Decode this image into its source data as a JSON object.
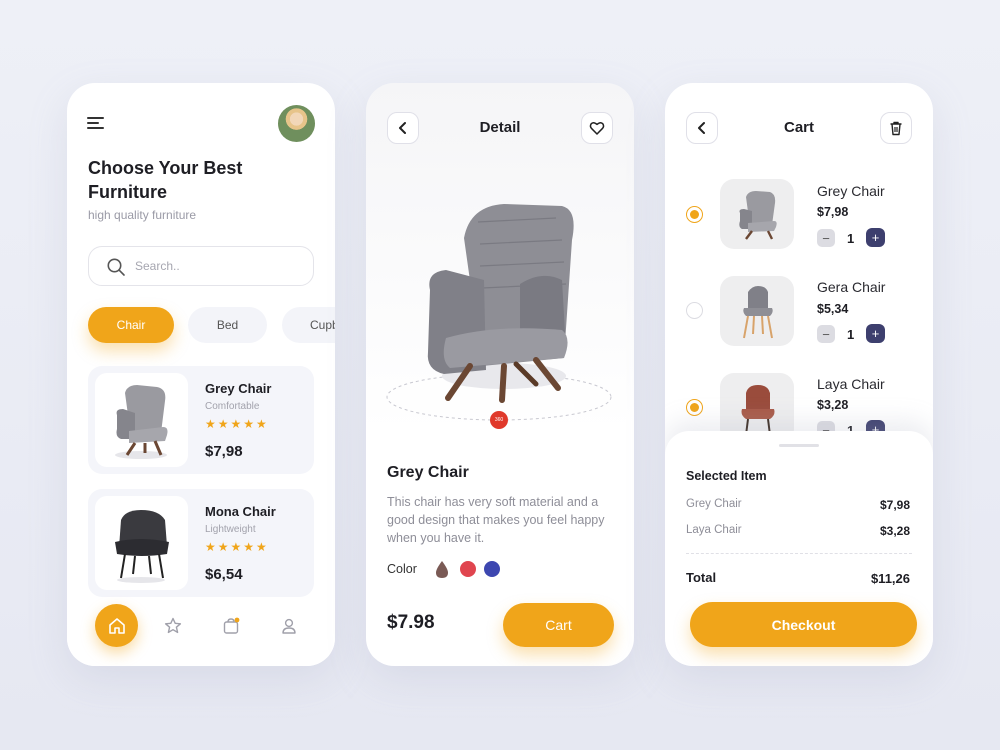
{
  "colors": {
    "accent": "#f0a51a",
    "dark_button": "#3d3f6e",
    "swatch_brown": "#7a5a55",
    "swatch_red": "#e0454f",
    "swatch_blue": "#3d47b0"
  },
  "home": {
    "title": "Choose Your Best Furniture",
    "subtitle": "high quality furniture",
    "search_placeholder": "Search..",
    "categories": [
      "Chair",
      "Bed",
      "Cupb"
    ],
    "products": [
      {
        "name": "Grey Chair",
        "tag": "Comfortable",
        "stars": "★★★★★",
        "price": "$7,98"
      },
      {
        "name": "Mona Chair",
        "tag": "Lightweight",
        "stars": "★★★★★",
        "price": "$6,54"
      }
    ],
    "nav": [
      "home-icon",
      "star-icon",
      "bag-icon",
      "profile-icon"
    ]
  },
  "detail": {
    "title": "Detail",
    "hotspot": "360",
    "name": "Grey Chair",
    "description": "This chair has very soft material and a good design that makes you feel happy when you have it.",
    "color_label": "Color",
    "price": "$7.98",
    "cart_label": "Cart"
  },
  "cart": {
    "title": "Cart",
    "items": [
      {
        "name": "Grey Chair",
        "price": "$7,98",
        "qty": "1",
        "selected": true
      },
      {
        "name": "Gera Chair",
        "price": "$5,34",
        "qty": "1",
        "selected": false
      },
      {
        "name": "Laya Chair",
        "price": "$3,28",
        "qty": "1",
        "selected": true
      }
    ],
    "minus": "−",
    "plus": "+",
    "selected_title": "Selected Item",
    "selected": [
      {
        "name": "Grey Chair",
        "price": "$7,98"
      },
      {
        "name": "Laya Chair",
        "price": "$3,28"
      }
    ],
    "total_label": "Total",
    "total_value": "$11,26",
    "checkout_label": "Checkout"
  }
}
